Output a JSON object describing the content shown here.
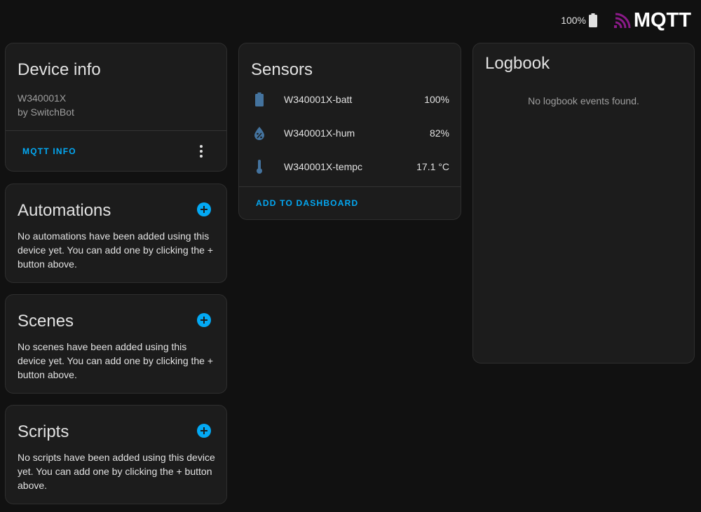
{
  "header": {
    "battery_percent": "100%",
    "logo_text": "MQTT",
    "logo_color": "#8b1a89"
  },
  "device_info": {
    "title": "Device info",
    "model": "W340001X",
    "manufacturer": "by SwitchBot",
    "mqtt_info_label": "MQTT INFO"
  },
  "automations": {
    "title": "Automations",
    "description": "No automations have been added using this device yet. You can add one by clicking the + button above."
  },
  "scenes": {
    "title": "Scenes",
    "description": "No scenes have been added using this device yet. You can add one by clicking the + button above."
  },
  "scripts": {
    "title": "Scripts",
    "description": "No scripts have been added using this device yet. You can add one by clicking the + button above."
  },
  "sensors": {
    "title": "Sensors",
    "items": [
      {
        "icon": "battery-icon",
        "name": "W340001X-batt",
        "value": "100%"
      },
      {
        "icon": "water-percent-icon",
        "name": "W340001X-hum",
        "value": "82%"
      },
      {
        "icon": "thermometer-icon",
        "name": "W340001X-tempc",
        "value": "17.1 °C"
      }
    ],
    "add_to_dashboard_label": "ADD TO DASHBOARD"
  },
  "logbook": {
    "title": "Logbook",
    "empty_message": "No logbook events found."
  },
  "colors": {
    "accent": "#03a9f4",
    "sensor_icon": "#44739e",
    "card_background": "#1c1c1c",
    "page_background": "#111111"
  }
}
